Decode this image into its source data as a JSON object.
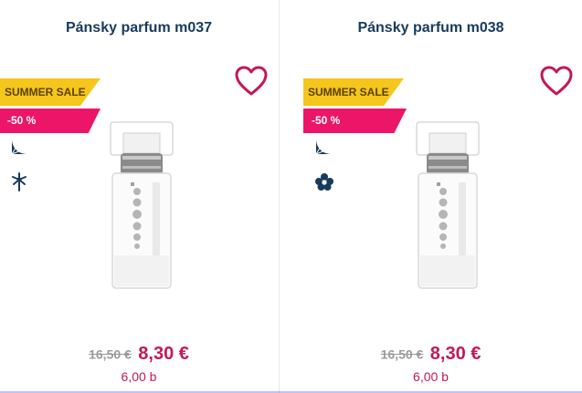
{
  "products": [
    {
      "title": "Pánsky parfum m037",
      "sale_badge": "SUMMER SALE",
      "discount_badge": "-50 %",
      "notes": [
        "citrus-icon",
        "aquatic-flower-icon"
      ],
      "old_price": "16,50 €",
      "new_price": "8,30 €",
      "points": "6,00 b"
    },
    {
      "title": "Pánsky parfum m038",
      "sale_badge": "SUMMER SALE",
      "discount_badge": "-50 %",
      "notes": [
        "citrus-icon",
        "flower-icon"
      ],
      "old_price": "16,50 €",
      "new_price": "8,30 €",
      "points": "6,00 b"
    }
  ],
  "colors": {
    "title": "#173b5c",
    "heart": "#c2185b",
    "sale_badge": "#f5c61c",
    "discount_badge": "#ec1669",
    "price": "#c2185b",
    "note_icon": "#173b5c"
  }
}
